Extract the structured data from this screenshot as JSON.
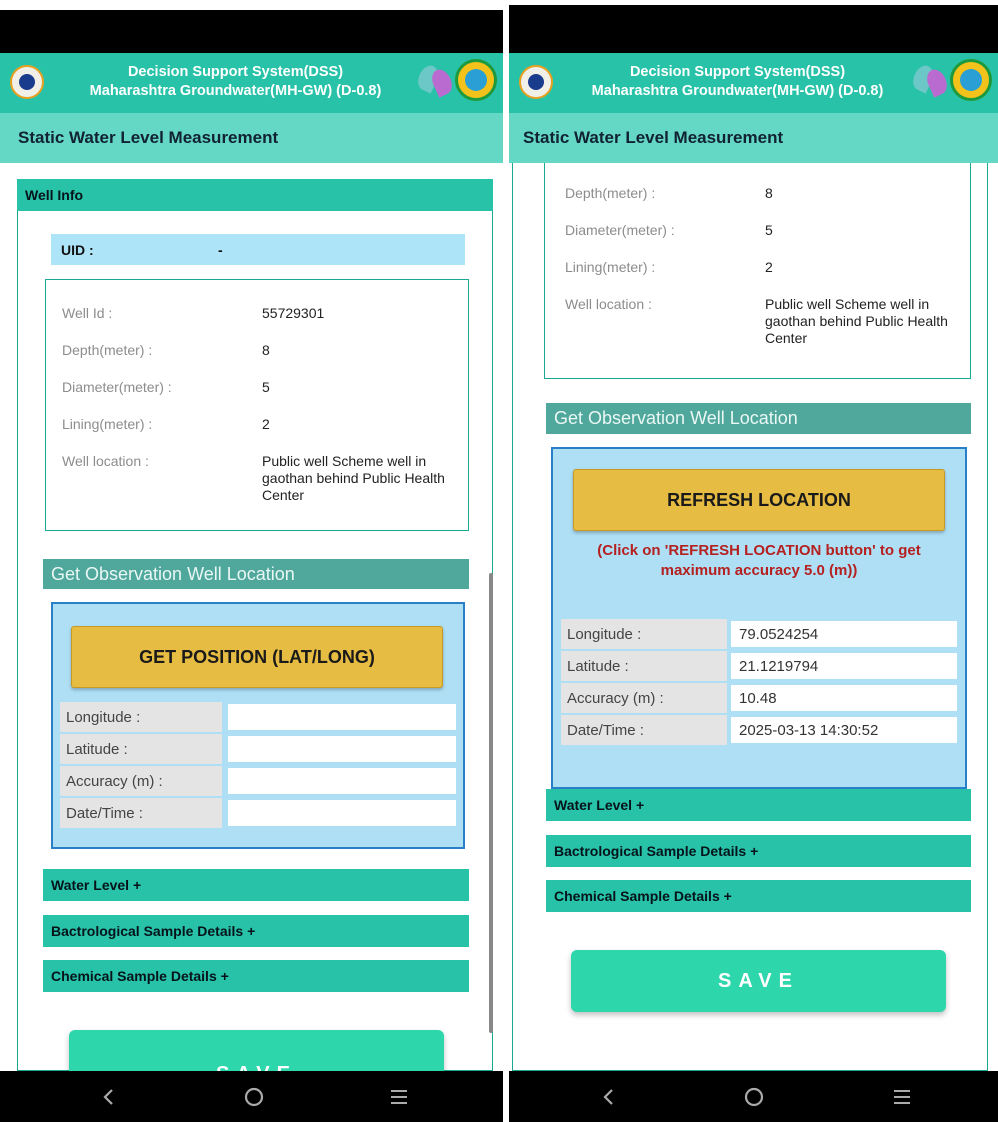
{
  "app": {
    "title_line1": "Decision Support System(DSS)",
    "title_line2": "Maharashtra Groundwater(MH-GW) (D-0.8)",
    "page_title": "Static Water Level Measurement"
  },
  "left_screen": {
    "well_info_header": "Well Info",
    "uid_label": "UID :",
    "uid_value": "-",
    "fields": [
      {
        "label": "Well Id :",
        "value": "55729301"
      },
      {
        "label": "Depth(meter) :",
        "value": "8"
      },
      {
        "label": "Diameter(meter) :",
        "value": "5"
      },
      {
        "label": "Lining(meter) :",
        "value": "2"
      },
      {
        "label": "Well location :",
        "value": "Public well Scheme well in gaothan behind Public Health Center"
      }
    ],
    "location_header": "Get Observation Well Location",
    "get_position_label": "GET POSITION (LAT/LONG)",
    "geo_fields": [
      {
        "label": "Longitude :",
        "value": ""
      },
      {
        "label": "Latitude :",
        "value": ""
      },
      {
        "label": "Accuracy (m) :",
        "value": ""
      },
      {
        "label": "Date/Time :",
        "value": ""
      }
    ],
    "sections": [
      "Water Level +",
      "Bactrological Sample Details  +",
      "Chemical Sample Details +"
    ],
    "save_label": "SAVE"
  },
  "right_screen": {
    "fields": [
      {
        "label": "Depth(meter) :",
        "value": "8"
      },
      {
        "label": "Diameter(meter) :",
        "value": "5"
      },
      {
        "label": "Lining(meter) :",
        "value": "2"
      },
      {
        "label": "Well location :",
        "value": "Public well Scheme well in gaothan behind Public Health Center"
      }
    ],
    "location_header": "Get Observation Well Location",
    "refresh_label": "REFRESH LOCATION",
    "hint": "(Click on 'REFRESH LOCATION button' to get maximum accuracy 5.0 (m))",
    "geo_fields": [
      {
        "label": "Longitude :",
        "value": "79.0524254"
      },
      {
        "label": "Latitude :",
        "value": "21.1219794"
      },
      {
        "label": "Accuracy (m) :",
        "value": "10.48"
      },
      {
        "label": "Date/Time :",
        "value": "2025-03-13 14:30:52"
      }
    ],
    "sections": [
      "Water Level +",
      "Bactrological Sample Details  +",
      "Chemical Sample Details +"
    ],
    "save_label": "SAVE"
  },
  "nav_icons": [
    "back-icon",
    "home-icon",
    "recents-icon"
  ],
  "colors": {
    "header": "#28c2a8",
    "title_bar": "#64d8c4",
    "geo_header": "#4fa89b",
    "geo_box": "#aedff5",
    "button_gold": "#e6bc42",
    "save_button": "#2dd6ab",
    "hint_text": "#b52020"
  }
}
